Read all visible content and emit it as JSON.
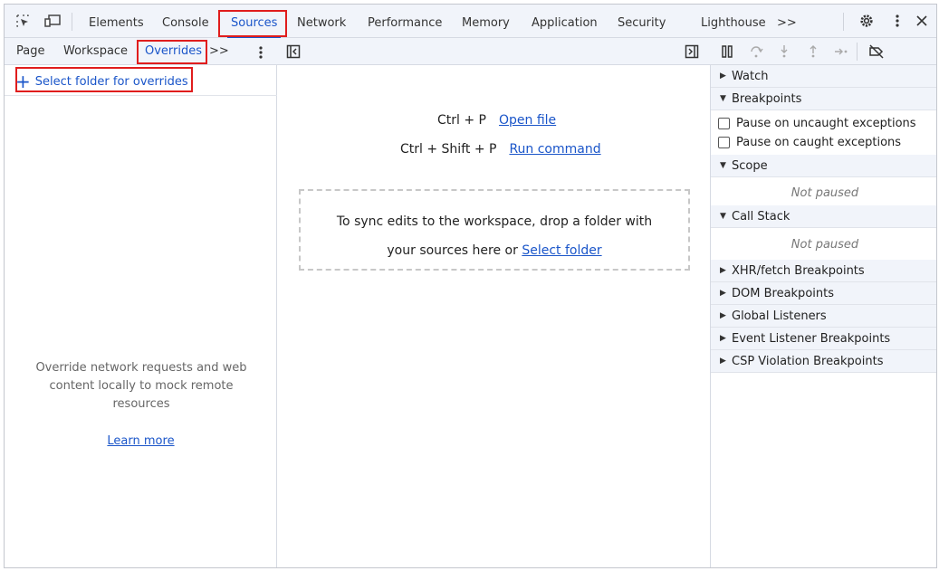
{
  "toolbar": {
    "tabs": [
      "Elements",
      "Console",
      "Sources",
      "Network",
      "Performance",
      "Memory",
      "Application",
      "Security",
      "Lighthouse"
    ],
    "more": ">>",
    "active": "Sources"
  },
  "navigator": {
    "tabs": [
      "Page",
      "Workspace",
      "Overrides"
    ],
    "more": ">>",
    "select_folder": "Select folder for overrides",
    "message": "Override network requests and web content locally to mock remote resources",
    "learn_more": "Learn more"
  },
  "editor": {
    "shortcut1_keys": "Ctrl + P",
    "shortcut1_action": "Open file",
    "shortcut2_keys": "Ctrl + Shift + P",
    "shortcut2_action": "Run command",
    "drop_text1": "To sync edits to the workspace, drop a folder with",
    "drop_text2": "your sources here or",
    "drop_link": "Select folder"
  },
  "debugger": {
    "watch": "Watch",
    "breakpoints": "Breakpoints",
    "pause_uncaught": "Pause on uncaught exceptions",
    "pause_caught": "Pause on caught exceptions",
    "scope": "Scope",
    "not_paused": "Not paused",
    "call_stack": "Call Stack",
    "xhr": "XHR/fetch Breakpoints",
    "dom": "DOM Breakpoints",
    "global": "Global Listeners",
    "event": "Event Listener Breakpoints",
    "csp": "CSP Violation Breakpoints"
  },
  "colors": {
    "accent": "#1a55c9",
    "highlight": "#e01d1d",
    "panel_bg": "#f1f4fa"
  }
}
